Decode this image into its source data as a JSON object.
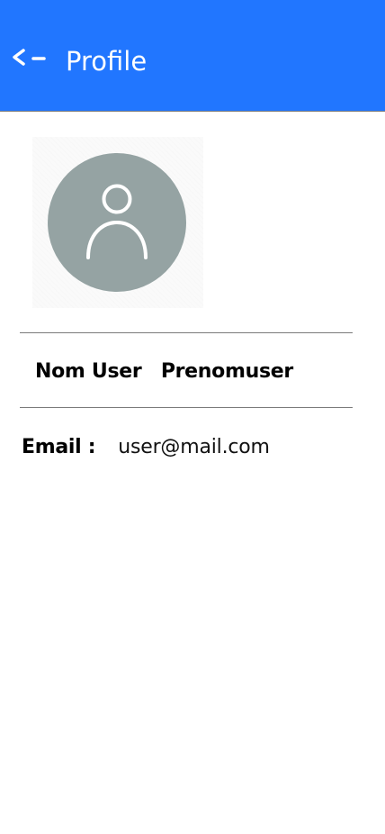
{
  "header": {
    "back_icon": "back-arrow-icon",
    "back_label": "<-",
    "title": "Profile",
    "background_color": "#2176ff"
  },
  "avatar": {
    "icon": "user-avatar-icon",
    "circle_color": "#95a3a3"
  },
  "profile": {
    "last_name": "Nom User",
    "first_name": "Prenomuser",
    "email_label": "Email :",
    "email_value": "user@mail.com"
  }
}
